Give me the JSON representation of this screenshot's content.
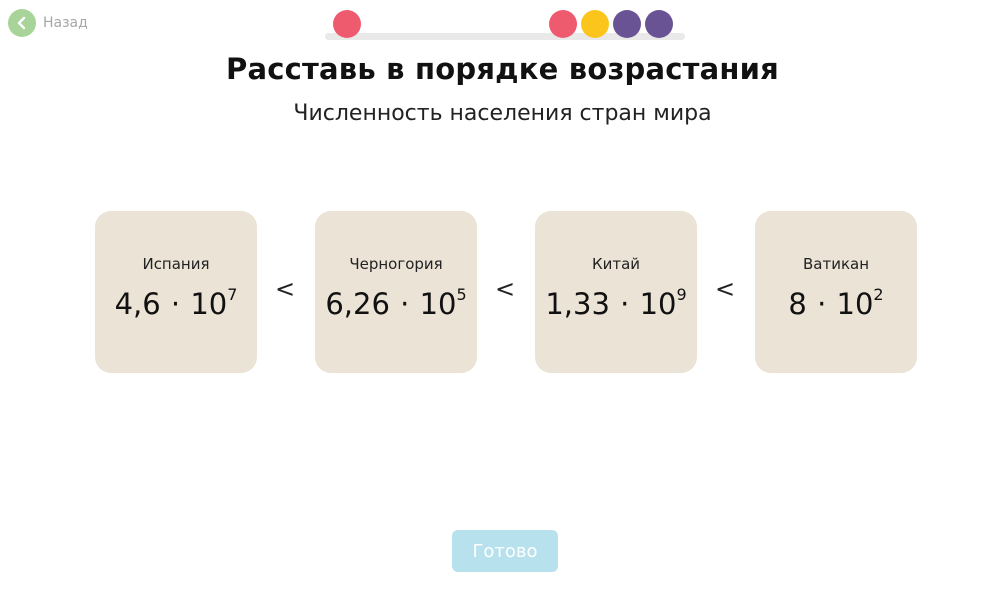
{
  "back": {
    "label": "Назад",
    "icon": "chevron-left-icon",
    "color": "#a8d49a"
  },
  "progress": {
    "steps": [
      {
        "color": "#ef5b6e"
      },
      {
        "color": "#ef5b6e"
      },
      {
        "color": "#fbc51c"
      },
      {
        "color": "#6a5394"
      },
      {
        "color": "#6a5394"
      }
    ]
  },
  "title": "Расставь в порядке возрастания",
  "subtitle": "Численность населения стран мира",
  "cards": [
    {
      "name": "Испания",
      "mantissa": "4,6",
      "dot": "·",
      "base": "10",
      "exponent": "7"
    },
    {
      "name": "Черногория",
      "mantissa": "6,26",
      "dot": "·",
      "base": "10",
      "exponent": "5"
    },
    {
      "name": "Китай",
      "mantissa": "1,33",
      "dot": "·",
      "base": "10",
      "exponent": "9"
    },
    {
      "name": "Ватикан",
      "mantissa": "8",
      "dot": "·",
      "base": "10",
      "exponent": "2"
    }
  ],
  "separators": [
    "<",
    "<",
    "<"
  ],
  "done_button": {
    "label": "Готово",
    "color": "#b8e1ee"
  }
}
